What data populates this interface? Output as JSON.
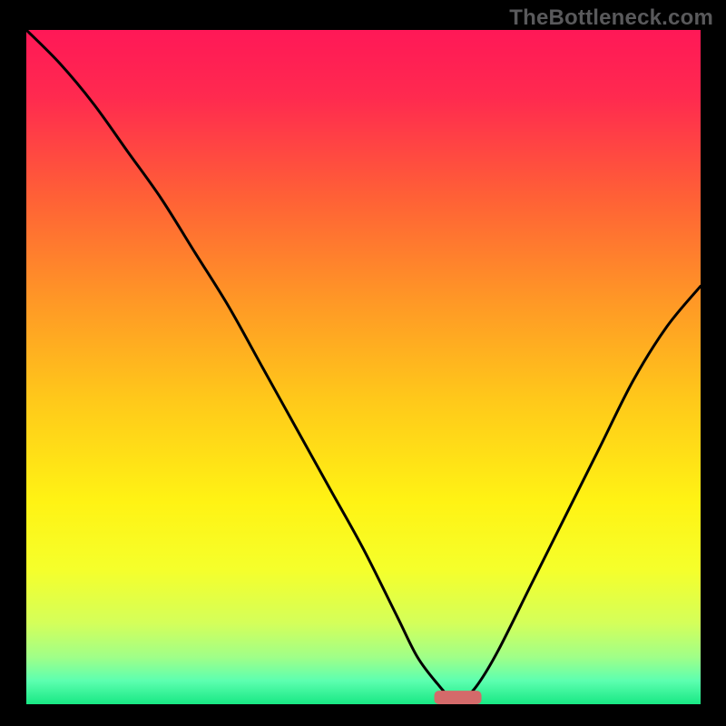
{
  "watermark": "TheBottleneck.com",
  "accent": {
    "marker_color": "#d46a6a"
  },
  "chart_data": {
    "type": "line",
    "title": "",
    "xlabel": "",
    "ylabel": "",
    "xlim": [
      0,
      100
    ],
    "ylim": [
      0,
      100
    ],
    "grid": false,
    "legend": false,
    "series": [
      {
        "name": "bottleneck-curve",
        "x": [
          0,
          5,
          10,
          15,
          20,
          25,
          30,
          35,
          40,
          45,
          50,
          55,
          58,
          61,
          63,
          65,
          67,
          70,
          75,
          80,
          85,
          90,
          95,
          100
        ],
        "values": [
          100,
          95,
          89,
          82,
          75,
          67,
          59,
          50,
          41,
          32,
          23,
          13,
          7,
          3,
          1,
          1,
          3,
          8,
          18,
          28,
          38,
          48,
          56,
          62
        ]
      }
    ],
    "marker": {
      "name": "optimal-point",
      "x_center": 64,
      "y": 0,
      "width": 7,
      "height": 2
    },
    "background": {
      "type": "vertical-gradient",
      "stops": [
        {
          "pos": 0.0,
          "color": "#ff1857"
        },
        {
          "pos": 0.1,
          "color": "#ff2a4f"
        },
        {
          "pos": 0.25,
          "color": "#ff6136"
        },
        {
          "pos": 0.4,
          "color": "#ff9726"
        },
        {
          "pos": 0.55,
          "color": "#ffc91a"
        },
        {
          "pos": 0.7,
          "color": "#fff314"
        },
        {
          "pos": 0.8,
          "color": "#f5ff2b"
        },
        {
          "pos": 0.88,
          "color": "#d4ff5a"
        },
        {
          "pos": 0.93,
          "color": "#a0ff88"
        },
        {
          "pos": 0.965,
          "color": "#5dffb0"
        },
        {
          "pos": 1.0,
          "color": "#18e884"
        }
      ]
    }
  }
}
